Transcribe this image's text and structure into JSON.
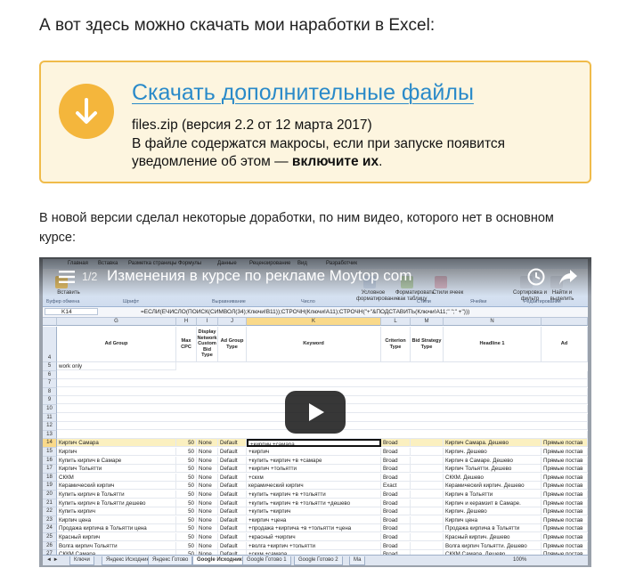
{
  "heading": "А вот здесь можно скачать мои наработки в Excel:",
  "download": {
    "link_text": "Скачать дополнительные файлы",
    "file_info": "files.zip (версия 2.2 от 12 марта 2017)",
    "note_prefix": "В файле содержатся макросы, если при запуске появится уведомление об этом — ",
    "note_bold": "включите их",
    "note_suffix": ".",
    "icon": "download-arrow-icon",
    "accent_color": "#f4b63c",
    "link_color": "#2a8ac9"
  },
  "paragraph": "В новой версии сделал некоторые доработки, по ним видео, которого нет в основном курсе:",
  "video": {
    "counter": "1/2",
    "title": "Изменения в курсе по рекламе Moytop com",
    "icons": [
      "menu-icon",
      "watch-later-icon",
      "share-icon",
      "play-icon"
    ]
  },
  "excel": {
    "ribbon_tabs": [
      "Главная",
      "Вставка",
      "Разметка страницы",
      "Формулы",
      "Данные",
      "Рецензирование",
      "Вид",
      "Разработчик"
    ],
    "ribbon_groups": [
      "Буфер обмена",
      "Шрифт",
      "Выравнивание",
      "Число",
      "Стили",
      "Ячейки",
      "Редактирование"
    ],
    "ribbon_labels": [
      "Вставить",
      "Условное форматирование",
      "Форматировать как таблицу",
      "Стили ячеек",
      "Сортировка и фильтр",
      "Найти и выделить"
    ],
    "name_box": "K14",
    "formula": "=ЕСЛИ(ЕЧИСЛО(ПОИСК(СИМВОЛ(34);Ключи!B11));СТРОЧН(Ключи!A11);СТРОЧН(\"+\"&ПОДСТАВИТЬ(Ключи!A11;\" \";\" +\")))",
    "columns": [
      "G",
      "H",
      "I",
      "J",
      "K",
      "L",
      "M",
      "N"
    ],
    "header_row": [
      "Ad Group",
      "Max CPC",
      "Display Network Custom Bid Type",
      "Ad Group Type",
      "Keyword",
      "Criterion Type",
      "Bid Strategy Type",
      "Headline 1",
      "Ad"
    ],
    "row_numbers": [
      "4",
      "5",
      "6",
      "7",
      "8",
      "9",
      "10",
      "11",
      "12",
      "13",
      "14",
      "15",
      "16",
      "17",
      "18",
      "19",
      "20",
      "21",
      "22",
      "23",
      "24",
      "25",
      "26",
      "27",
      "28"
    ],
    "row5_label": "work only",
    "rows": [
      {
        "num": "14",
        "g": "Кирпич Самара",
        "h": "50",
        "i": "None",
        "j": "Default",
        "k": "+кирпич +самара",
        "l": "Broad",
        "n": "Кирпич Самара. Дешево",
        "o": "Прямые постав"
      },
      {
        "num": "15",
        "g": "Кирпич",
        "h": "50",
        "i": "None",
        "j": "Default",
        "k": "+кирпич",
        "l": "Broad",
        "n": "Кирпич. Дешево",
        "o": "Прямые постав"
      },
      {
        "num": "16",
        "g": "Купить кирпич в Самаре",
        "h": "50",
        "i": "None",
        "j": "Default",
        "k": "+купить +кирпич +в +самаре",
        "l": "Broad",
        "n": "Кирпич в Самаре. Дешево",
        "o": "Прямые постав"
      },
      {
        "num": "17",
        "g": "Кирпич Тольятти",
        "h": "50",
        "i": "None",
        "j": "Default",
        "k": "+кирпич +тольятти",
        "l": "Broad",
        "n": "Кирпич Тольятти. Дешево",
        "o": "Прямые постав"
      },
      {
        "num": "18",
        "g": "СККМ",
        "h": "50",
        "i": "None",
        "j": "Default",
        "k": "+скхм",
        "l": "Broad",
        "n": "СККМ. Дешево",
        "o": "Прямые постав"
      },
      {
        "num": "19",
        "g": "Керамический кирпич",
        "h": "50",
        "i": "None",
        "j": "Default",
        "k": "керамический кирпич",
        "l": "Exact",
        "n": "Керамический кирпич. Дешево",
        "o": "Прямые постав"
      },
      {
        "num": "20",
        "g": "Купить кирпич в Тольятти",
        "h": "50",
        "i": "None",
        "j": "Default",
        "k": "+купить +кирпич +в +тольятти",
        "l": "Broad",
        "n": "Кирпич в Тольятти",
        "o": "Прямые постав"
      },
      {
        "num": "21",
        "g": "Купить кирпич в Тольятти дешево",
        "h": "50",
        "i": "None",
        "j": "Default",
        "k": "+купить +кирпич +в +тольятти +дешево",
        "l": "Broad",
        "n": "Кирпич и керамзит в Самаре.",
        "o": "Прямые постав"
      },
      {
        "num": "22",
        "g": "Купить кирпич",
        "h": "50",
        "i": "None",
        "j": "Default",
        "k": "+купить +кирпич",
        "l": "Broad",
        "n": "Кирпич. Дешево",
        "o": "Прямые постав"
      },
      {
        "num": "23",
        "g": "Кирпич цена",
        "h": "50",
        "i": "None",
        "j": "Default",
        "k": "+кирпич +цена",
        "l": "Broad",
        "n": "Кирпич цена",
        "o": "Прямые постав"
      },
      {
        "num": "24",
        "g": "Продажа кирпича в Тольятти цена",
        "h": "50",
        "i": "None",
        "j": "Default",
        "k": "+продажа +кирпича +в +тольятти +цена",
        "l": "Broad",
        "n": "Продажа кирпича в Тольятти",
        "o": "Прямые постав"
      },
      {
        "num": "25",
        "g": "Красный кирпич",
        "h": "50",
        "i": "None",
        "j": "Default",
        "k": "+красный +кирпич",
        "l": "Broad",
        "n": "Красный кирпич. Дешево",
        "o": "Прямые постав"
      },
      {
        "num": "26",
        "g": "Волга кирпич Тольятти",
        "h": "50",
        "i": "None",
        "j": "Default",
        "k": "+волга +кирпич +тольятти",
        "l": "Broad",
        "n": "Волга кирпич Тольятти. Дешево",
        "o": "Прямые постав"
      },
      {
        "num": "27",
        "g": "СККМ Самара",
        "h": "50",
        "i": "None",
        "j": "Default",
        "k": "+скхм +самара",
        "l": "Broad",
        "n": "СККМ Самара. Дешево",
        "o": "Прямые постав"
      },
      {
        "num": "28",
        "g": "Кирпич цена за штуку",
        "h": "50",
        "i": "None",
        "j": "Default",
        "k": "+кирпич +цена +за +штуку",
        "l": "Broad",
        "n": "Кирпич цена за штуку. Дешево",
        "o": "Прямые постав"
      }
    ],
    "sheet_tabs": [
      "Ключи",
      "Яндекс Исходник",
      "Яндекс Готово",
      "Google Исходник",
      "Google Готово 1",
      "Google Готово 2",
      "Ма"
    ],
    "active_sheet": "Google Исходник",
    "status_left": "Готово",
    "zoom": "100%"
  }
}
